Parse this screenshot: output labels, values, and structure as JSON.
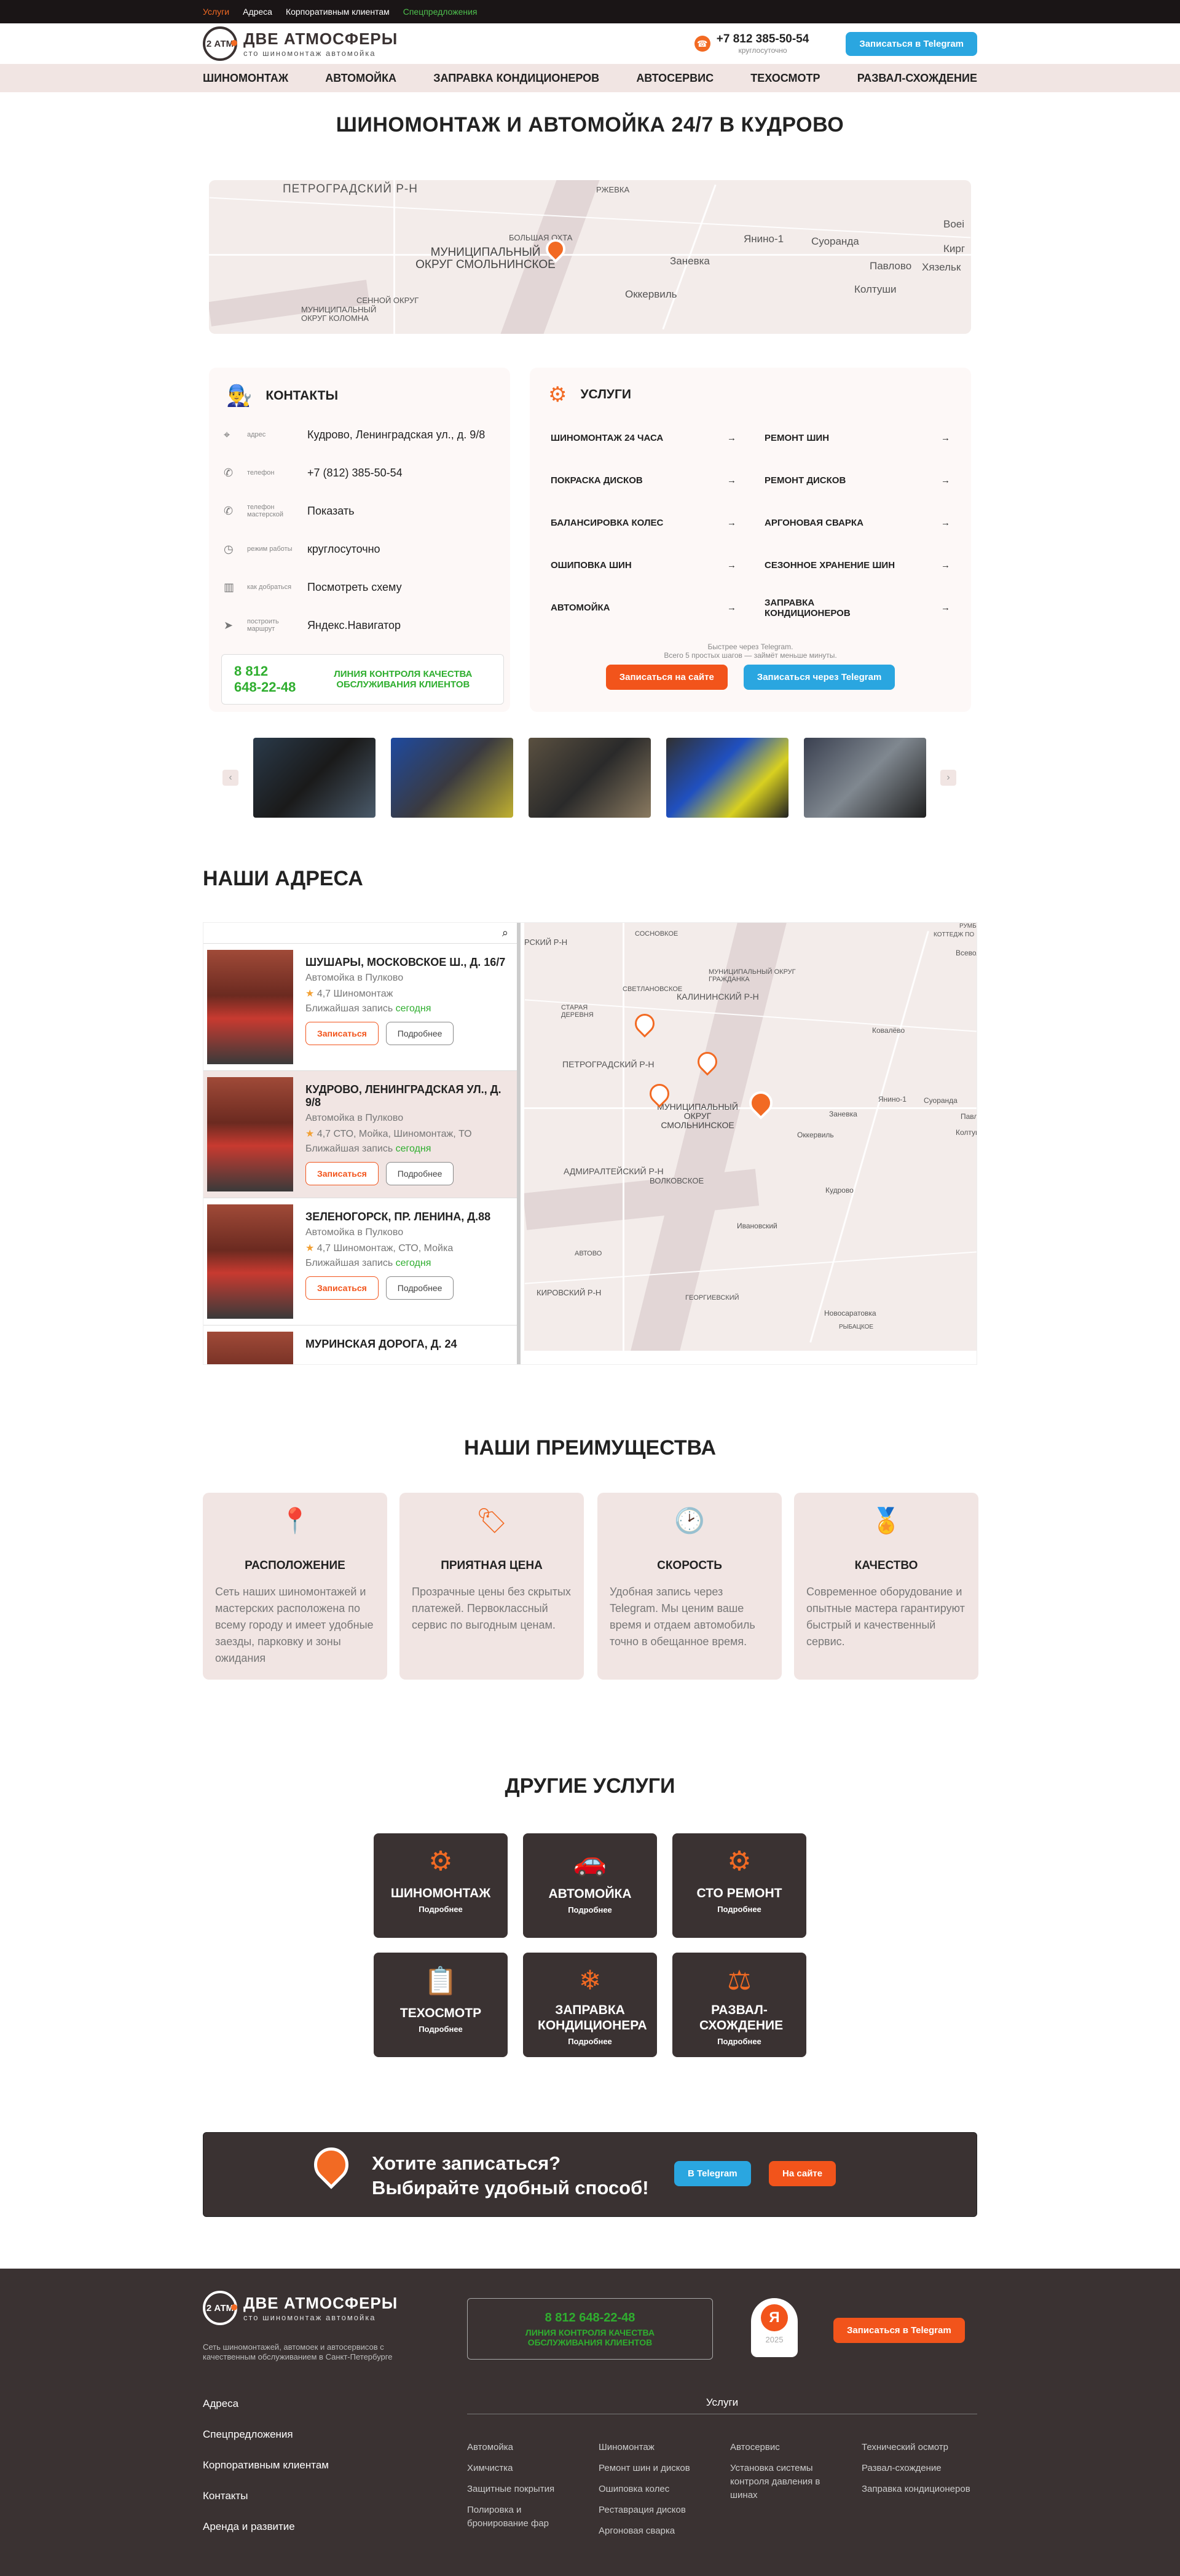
{
  "topbar": {
    "links": [
      "Услуги",
      "Адреса",
      "Корпоративным клиентам",
      "Спецпредложения"
    ]
  },
  "header": {
    "brand": "ДВЕ АТМОСФЕРЫ",
    "brand_sub": "сто  шиномонтаж  автомойка",
    "badge": "2 АТМ",
    "phone": "+7 812 385-50-54",
    "phone_sub": "круглосуточно",
    "tg_button": "Записаться в Telegram"
  },
  "nav": [
    "ШИНОМОНТАЖ",
    "АВТОМОЙКА",
    "ЗАПРАВКА КОНДИЦИОНЕРОВ",
    "АВТОСЕРВИС",
    "ТЕХОСМОТР",
    "РАЗВАЛ-СХОЖДЕНИЕ"
  ],
  "hero": {
    "title": "ШИНОМОНТАЖ И АВТОМОЙКА 24/7 В КУДРОВО"
  },
  "map1": {
    "labels": [
      "ПЕТРОГРАДСКИЙ Р-Н",
      "РЖЕВКА",
      "БОЛЬШАЯ ОХТА",
      "МУНИЦИПАЛЬНЫЙ ОКРУГ СМОЛЬНИНСКОЕ",
      "Заневка",
      "Янино-1",
      "Суоранда",
      "Воеі",
      "Кирг",
      "Павлово",
      "Хязельк",
      "Колтуши",
      "Оккервиль",
      "СЕННОЙ ОКРУГ",
      "МУНИЦИПАЛЬНЫЙ ОКРУГ КОЛОМНА"
    ]
  },
  "contacts": {
    "title": "КОНТАКТЫ",
    "rows": [
      {
        "k": "адрес",
        "v": "Кудрово, Ленинградская ул., д. 9/8"
      },
      {
        "k": "телефон",
        "v": "+7 (812) 385-50-54"
      },
      {
        "k": "телефон мастерской",
        "v": "Показать"
      },
      {
        "k": "режим работы",
        "v": "круглосуточно"
      },
      {
        "k": "как добраться",
        "v": "Посмотреть схему"
      },
      {
        "k": "построить маршрут",
        "v": "Яндекс.Навигатор"
      }
    ],
    "hotline": "8 812 648-22-48",
    "hotline_text": "ЛИНИЯ КОНТРОЛЯ КАЧЕСТВА ОБСЛУЖИВАНИЯ КЛИЕНТОВ"
  },
  "services": {
    "title": "УСЛУГИ",
    "items": [
      "ШИНОМОНТАЖ 24 ЧАСА",
      "РЕМОНТ ШИН",
      "ПОКРАСКА ДИСКОВ",
      "РЕМОНТ ДИСКОВ",
      "БАЛАНСИРОВКА КОЛЕС",
      "АРГОНОВАЯ СВАРКА",
      "ОШИПОВКА ШИН",
      "СЕЗОННОЕ ХРАНЕНИЕ ШИН",
      "АВТОМОЙКА",
      "ЗАПРАВКА КОНДИЦИОНЕРОВ"
    ],
    "note1": "Быстрее через Telegram.",
    "note2": "Всего 5 простых шагов — займёт меньше минуты.",
    "btn_site": "Записаться на сайте",
    "btn_tg": "Записаться через Telegram"
  },
  "addresses": {
    "title": "НАШИ АДРЕСА",
    "items": [
      {
        "name": "ШУШАРЫ, МОСКОВСКОЕ Ш., Д. 16/7",
        "type": "Автомойка в Пулково",
        "rating": "4,7",
        "tags": "Шиномонтаж",
        "next": "Ближайшая запись",
        "when": "сегодня"
      },
      {
        "name": "КУДРОВО, ЛЕНИНГРАДСКАЯ УЛ., Д. 9/8",
        "type": "Автомойка в Пулково",
        "rating": "4,7",
        "tags": "СТО, Мойка, Шиномонтаж, ТО",
        "next": "Ближайшая запись",
        "when": "сегодня"
      },
      {
        "name": "ЗЕЛЕНОГОРСК, ПР. ЛЕНИНА, Д.88",
        "type": "Автомойка в Пулково",
        "rating": "4,7",
        "tags": "Шиномонтаж, СТО, Мойка",
        "next": "Ближайшая запись",
        "when": "сегодня"
      },
      {
        "name": "МУРИНСКАЯ ДОРОГА, Д. 24",
        "type": "",
        "rating": "",
        "tags": "",
        "next": "",
        "when": ""
      }
    ],
    "btn_book": "Записаться",
    "btn_more": "Подробнее"
  },
  "map2": {
    "labels": [
      "РСКИЙ Р-Н",
      "СОСНОВКОЕ",
      "КАЛИНИНСКИЙ Р-Н",
      "СВЕТЛАНОВСКОЕ",
      "МУНИЦИПАЛЬНЫЙ ОКРУГ ГРАЖДАНКА",
      "СТАРАЯ ДЕРЕВНЯ",
      "ПЕТРОГРАДСКИЙ Р-Н",
      "МУНИЦИПАЛЬНЫЙ ОКРУГ СМОЛЬНИНСКОЕ",
      "АДМИРАЛТЕЙСКИЙ Р-Н",
      "ВОЛКОВСКОЕ",
      "Ковалёво",
      "Заневка",
      "Янино-1",
      "Суоранда",
      "Кудрово",
      "Оккервиль",
      "Ивановский",
      "КИРОВСКИЙ Р-Н",
      "ГЕОРГИЕВСКИЙ",
      "Новосаратовка",
      "РЫБАЦКОЕ",
      "АВТОВО",
      "Всевол",
      "Колтуш",
      "Павл",
      "КОТТЕДЖ ПО",
      "РУМБ"
    ]
  },
  "advantages": {
    "title": "НАШИ ПРЕИМУЩЕСТВА",
    "items": [
      {
        "title": "РАСПОЛОЖЕНИЕ",
        "text": "Сеть наших шиномонтажей и мастерских расположена по всему городу и имеет удобные заезды, парковку и зоны ожидания"
      },
      {
        "title": "ПРИЯТНАЯ ЦЕНА",
        "text": "Прозрачные цены без скрытых платежей. Первоклассный сервис по выгодным ценам."
      },
      {
        "title": "СКОРОСТЬ",
        "text": "Удобная запись через Telegram. Мы ценим ваше время и отдаем автомобиль точно в обещанное время."
      },
      {
        "title": "КАЧЕСТВО",
        "text": "Современное оборудование и опытные мастера гарантируют быстрый и качественный сервис."
      }
    ]
  },
  "other": {
    "title": "ДРУГИЕ УСЛУГИ",
    "more": "Подробнее",
    "items": [
      "ШИНОМОНТАЖ",
      "АВТОМОЙКА",
      "СТО РЕМОНТ",
      "ТЕХОСМОТР",
      "ЗАПРАВКА КОНДИЦИОНЕРА",
      "РАЗВАЛ-СХОЖДЕНИЕ"
    ]
  },
  "cta": {
    "line1": "Хотите записаться?",
    "line2": "Выбирайте удобный способ!",
    "tg": "В Telegram",
    "site": "На сайте"
  },
  "footer": {
    "brand": "ДВЕ АТМОСФЕРЫ",
    "brand_sub": "сто  шиномонтаж  автомойка",
    "desc": "Сеть шиномонтажей, автомоек и автосервисов с качественным обслуживанием в Санкт-Петербурге",
    "hotline": "8 812 648-22-48",
    "hotline_text": "ЛИНИЯ КОНТРОЛЯ КАЧЕСТВА ОБСЛУЖИВАНИЯ КЛИЕНТОВ",
    "year": "2025",
    "tg": "Записаться в Telegram",
    "links": [
      "Адреса",
      "Спецпредложения",
      "Корпоративным клиентам",
      "Контакты",
      "Аренда и развитие"
    ],
    "services_title": "Услуги",
    "cols": [
      [
        "Автомойка",
        "Химчистка",
        "Защитные покрытия",
        "Полировка и бронирование фар"
      ],
      [
        "Шиномонтаж",
        "Ремонт шин и дисков",
        "Ошиповка колес",
        "Реставрация дисков",
        "Аргоновая сварка"
      ],
      [
        "Автосервис",
        "Установка системы контроля давления в шинах"
      ],
      [
        "Технический осмотр",
        "Развал-схождение",
        "Заправка кондиционеров"
      ]
    ]
  },
  "colors": {
    "accent": "#f26a23",
    "telegram": "#2aa6e0",
    "green": "#2fae2f",
    "dark": "#3a3232",
    "pink": "#f1e5e3"
  }
}
